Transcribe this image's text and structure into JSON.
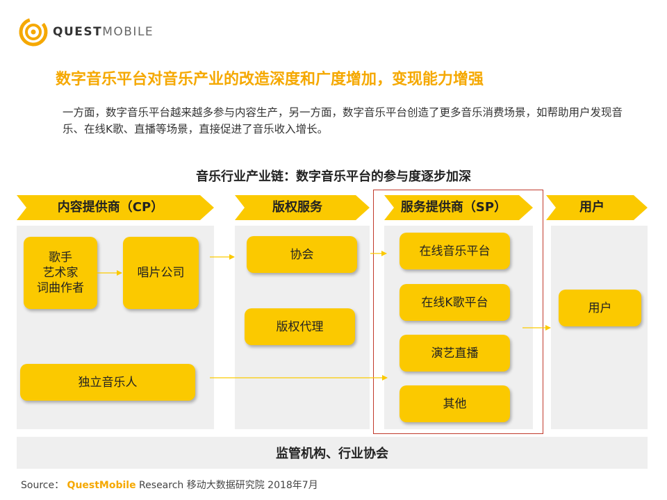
{
  "logo": {
    "text_bold": "QUEST",
    "text_light": "MOBILE"
  },
  "title": "数字音乐平台对音乐产业的改造深度和广度增加，变现能力增强",
  "intro": "一方面，数字音乐平台越来越多参与内容生产，另一方面，数字音乐平台创造了更多音乐消费场景，如帮助用户发现音乐、在线K歌、直播等场景，直接促进了音乐收入增长。",
  "diagram": {
    "title": "音乐行业产业链：数字音乐平台的参与度逐步加深",
    "stages": [
      {
        "label": "内容提供商（CP）"
      },
      {
        "label": "版权服务"
      },
      {
        "label": "服务提供商（SP）"
      },
      {
        "label": "用户"
      }
    ],
    "cp": {
      "artists": [
        "歌手",
        "艺术家",
        "词曲作者"
      ],
      "label_company": "唱片公司",
      "independent": "独立音乐人"
    },
    "copyright": {
      "association": "协会",
      "agency": "版权代理"
    },
    "sp": {
      "items": [
        "在线音乐平台",
        "在线K歌平台",
        "演艺直播",
        "其他"
      ]
    },
    "user": {
      "box": "用户"
    },
    "bottom": "监管机构、行业协会"
  },
  "source": {
    "prefix": "Source：",
    "brand": "QuestMobile",
    "rest": " Research 移动大数据研究院 2018年7月"
  },
  "colors": {
    "accent": "#f5a800",
    "box": "#fbc900",
    "panel": "#efefef",
    "highlight": "#c0392b"
  }
}
